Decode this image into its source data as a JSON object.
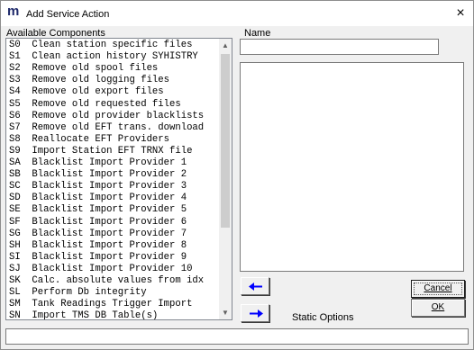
{
  "window": {
    "title": "Add Service Action",
    "app_icon_glyph": "m",
    "close_glyph": "×"
  },
  "labels": {
    "available_components": "Available Components",
    "name": "Name",
    "static_options": "Static Options"
  },
  "components": [
    "S0  Clean station specific files",
    "S1  Clean action history SYHISTRY",
    "S2  Remove old spool files",
    "S3  Remove old logging files",
    "S4  Remove old export files",
    "S5  Remove old requested files",
    "S6  Remove old provider blacklists",
    "S7  Remove old EFT trans. download",
    "S8  Reallocate EFT Providers",
    "S9  Import Station EFT TRNX file",
    "SA  Blacklist Import Provider 1",
    "SB  Blacklist Import Provider 2",
    "SC  Blacklist Import Provider 3",
    "SD  Blacklist Import Provider 4",
    "SE  Blacklist Import Provider 5",
    "SF  Blacklist Import Provider 6",
    "SG  Blacklist Import Provider 7",
    "SH  Blacklist Import Provider 8",
    "SI  Blacklist Import Provider 9",
    "SJ  Blacklist Import Provider 10",
    "SK  Calc. absolute values from idx",
    "SL  Perform Db integrity",
    "SM  Tank Readings Trigger Import",
    "SN  Import TMS DB Table(s)"
  ],
  "name_field": {
    "value": ""
  },
  "buttons": {
    "cancel": "Cancel",
    "ok": "OK"
  },
  "icons": {
    "add_left": "arrow-left-icon",
    "add_right": "arrow-right-icon",
    "arrow_color": "#0000ff"
  },
  "status_field": {
    "value": ""
  }
}
